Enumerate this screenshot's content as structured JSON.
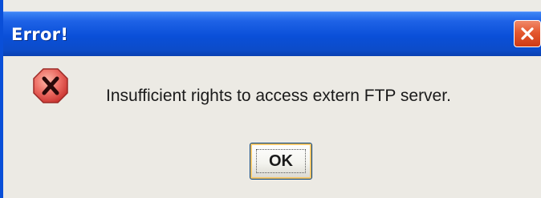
{
  "dialog": {
    "title": "Error!",
    "message": "Insufficient rights to access extern FTP server.",
    "ok_label": "OK"
  },
  "icons": {
    "error": "error-icon",
    "close": "close-icon"
  },
  "colors": {
    "titlebar": "#0a4fd8",
    "close_button": "#e4582f",
    "error_icon": "#e35a5a",
    "dialog_background": "#eceae4"
  }
}
